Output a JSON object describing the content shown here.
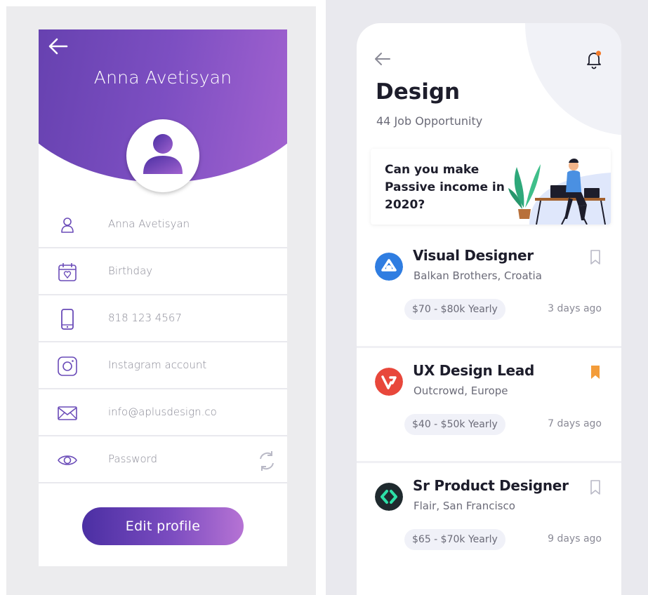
{
  "profile": {
    "name": "Anna Avetisyan",
    "fields": [
      {
        "icon": "user-icon",
        "label": "Anna Avetisyan"
      },
      {
        "icon": "calendar-icon",
        "label": "Birthday"
      },
      {
        "icon": "phone-icon",
        "label": "818 123 4567"
      },
      {
        "icon": "instagram-icon",
        "label": "Instagram account"
      },
      {
        "icon": "mail-icon",
        "label": "info@aplusdesign.co"
      },
      {
        "icon": "eye-icon",
        "label": "Password"
      }
    ],
    "edit_button": "Edit profile",
    "colors": {
      "gradient_start": "#4b2fa3",
      "gradient_end": "#b673d4",
      "icon": "#6a4bb8"
    }
  },
  "jobs": {
    "title": "Design",
    "subtitle": "44 Job Opportunity",
    "promo": "Can you make Passive income in 2020?",
    "items": [
      {
        "title": "Visual Designer",
        "company": "Balkan Brothers, Croatia",
        "salary": "$70 - $80k Yearly",
        "posted": "3 days ago",
        "bookmarked": false,
        "logo_color": "#2f7de1"
      },
      {
        "title": "UX Design Lead",
        "company": "Outcrowd, Europe",
        "salary": "$40 - $50k Yearly",
        "posted": "7 days ago",
        "bookmarked": true,
        "logo_color": "#e8473b"
      },
      {
        "title": "Sr Product Designer",
        "company": "Flair, San Francisco",
        "salary": "$65 - $70k Yearly",
        "posted": "9 days ago",
        "bookmarked": false,
        "logo_color": "#1f2a2e"
      }
    ],
    "colors": {
      "bookmark_active": "#f39c3a",
      "notification_dot": "#f47b2a"
    }
  }
}
